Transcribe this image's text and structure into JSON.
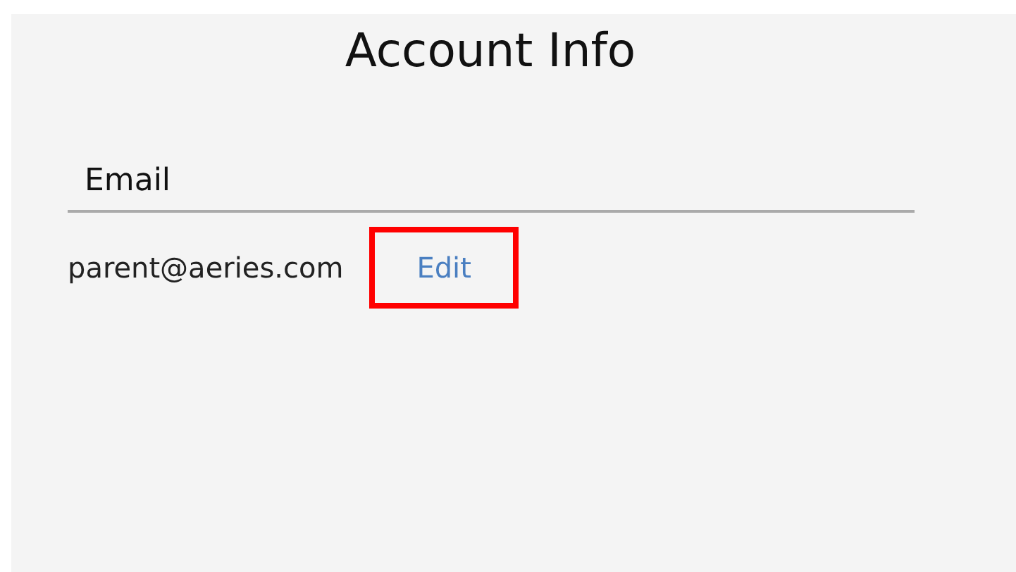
{
  "title": "Account Info",
  "fields": [
    {
      "label": "Email",
      "value": "parent@aeries.com",
      "action": {
        "label": "Edit",
        "highlighted": true
      }
    }
  ]
}
